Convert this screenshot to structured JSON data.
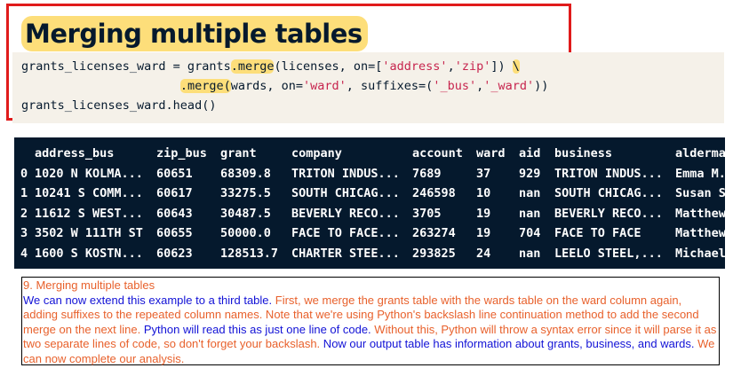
{
  "title": "Merging multiple tables",
  "code": {
    "line1_pre": "grants_licenses_ward = grants",
    "line1_merge": ".merge",
    "line1_args_open": "(licenses, on=[",
    "line1_str1": "'address'",
    "line1_comma": ",",
    "line1_str2": "'zip'",
    "line1_close": "]) ",
    "line1_backslash": "\\",
    "line2_indent": "                      ",
    "line2_merge": ".merge(",
    "line2_args": "wards, on=",
    "line2_str1": "'ward'",
    "line2_mid": ", suffixes=(",
    "line2_str2": "'_bus'",
    "line2_comma": ",",
    "line2_str3": "'_ward'",
    "line2_close": "))",
    "line3": "grants_licenses_ward.head()"
  },
  "table": {
    "headers": [
      "address_bus",
      "zip_bus",
      "grant",
      "company",
      "account",
      "ward",
      "aid",
      "business",
      "alderma"
    ],
    "rows": [
      {
        "index": "0",
        "cells": [
          "1020 N KOLMA...",
          "60651",
          "68309.8",
          "TRITON INDUS...",
          "7689",
          "37",
          "929",
          "TRITON INDUS...",
          "Emma M."
        ]
      },
      {
        "index": "1",
        "cells": [
          "10241 S COMM...",
          "60617",
          "33275.5",
          "SOUTH CHICAG...",
          "246598",
          "10",
          "nan",
          "SOUTH CHICAG...",
          "Susan S"
        ]
      },
      {
        "index": "2",
        "cells": [
          "11612 S WEST...",
          "60643",
          "30487.5",
          "BEVERLY RECO...",
          "3705",
          "19",
          "nan",
          "BEVERLY RECO...",
          "Matthew"
        ]
      },
      {
        "index": "3",
        "cells": [
          "3502 W 111TH ST",
          "60655",
          "50000.0",
          "FACE TO FACE...",
          "263274",
          "19",
          "704",
          "FACE TO FACE",
          "Matthew"
        ]
      },
      {
        "index": "4",
        "cells": [
          "1600 S KOSTN...",
          "60623",
          "128513.7",
          "CHARTER STEE...",
          "293825",
          "24",
          "nan",
          "LEELO STEEL,...",
          "Michael"
        ]
      }
    ]
  },
  "caption": {
    "title": "9. Merging multiple tables",
    "s1": "We can now extend this example to a third table.",
    "s2": " First, we merge the grants table with the wards table on the ward column again, adding suffixes to the repeated column names. Note that we're using Python's backslash line continuation method to add the second merge on the next line.",
    "s3": " Python will read this as just one line of code.",
    "s4": " Without this, Python will throw a syntax error since it will parse it as two separate lines of code, so don't forget your backslash.",
    "s5": " Now our output table has information about grants, business, and wards.",
    "s6": " We can now complete our analysis."
  },
  "colors": {
    "title_highlight": "#fdde7a",
    "title_border": "#e01b1b",
    "code_bg": "#f5f1e9",
    "output_bg": "#05192d",
    "caption_orange": "#e8612c",
    "caption_blue": "#1212d6"
  }
}
